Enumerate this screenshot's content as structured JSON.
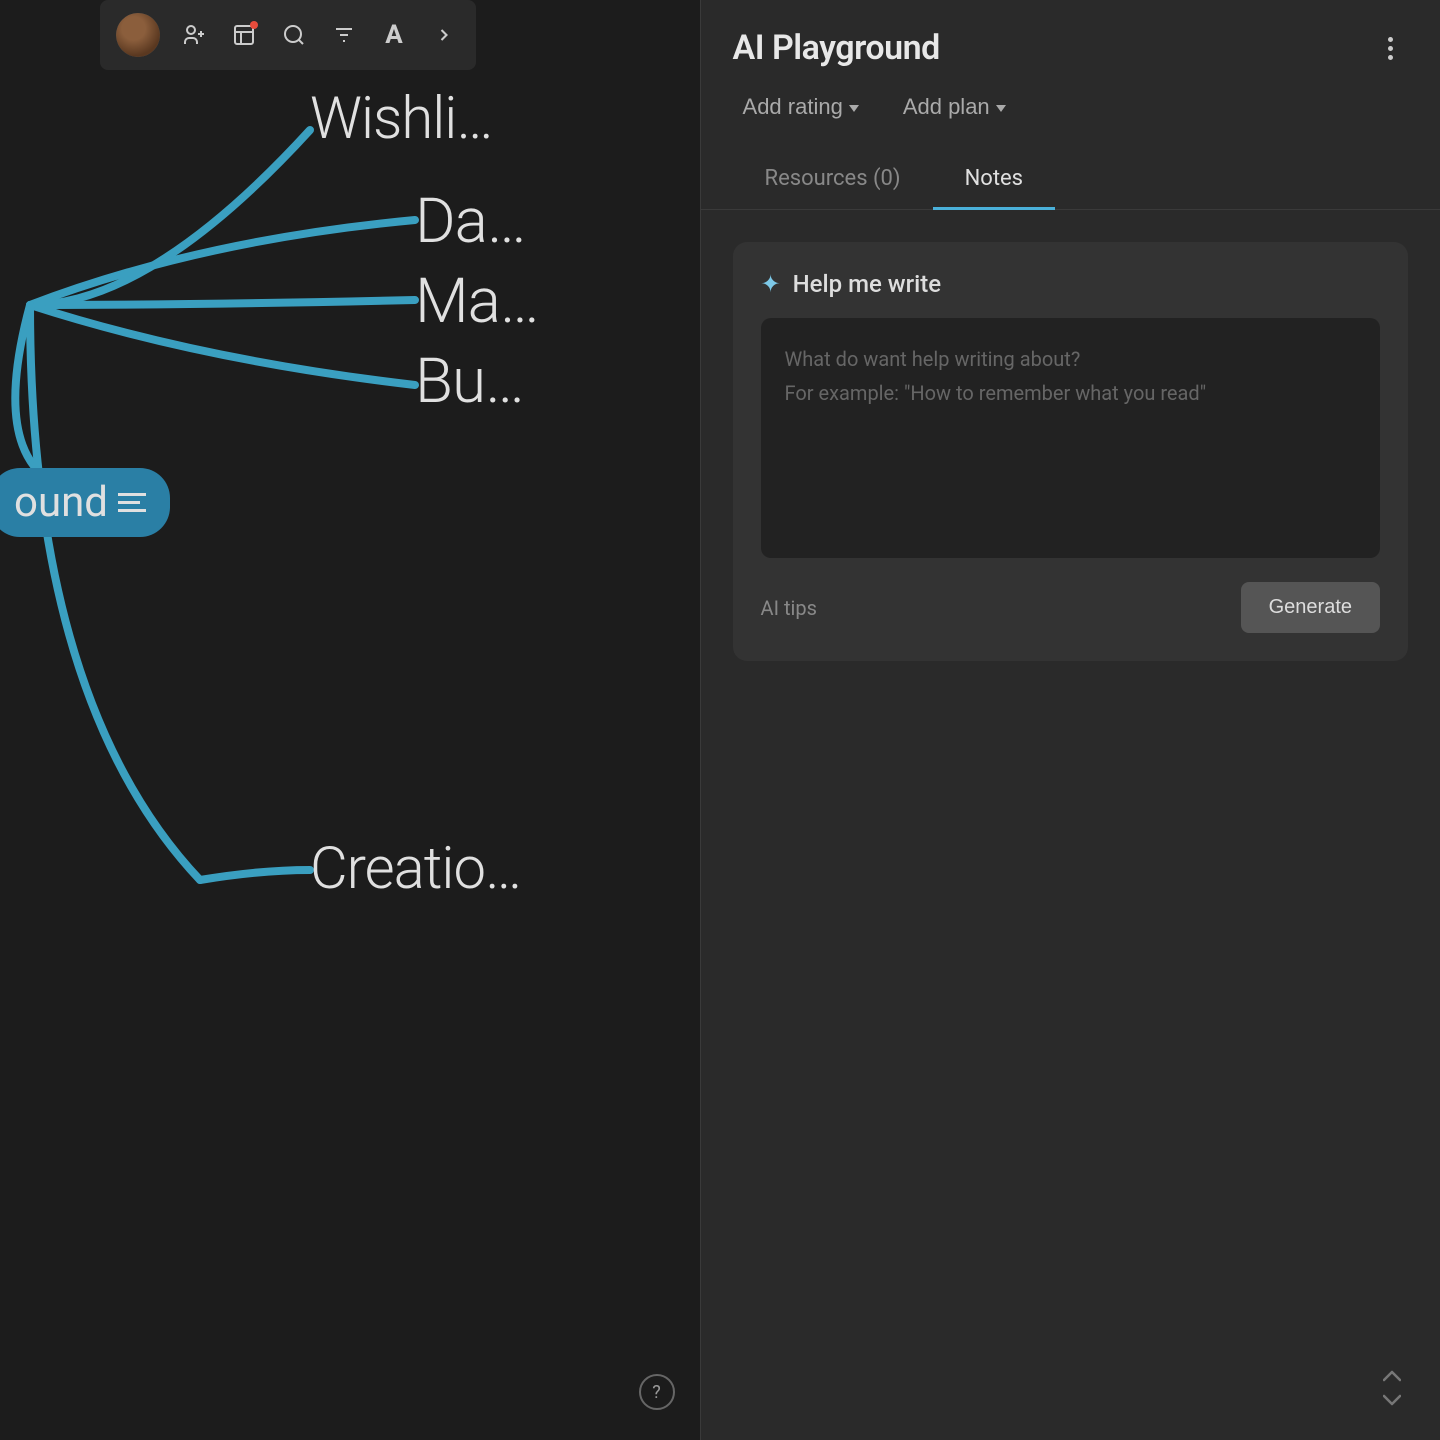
{
  "mindmap": {
    "nodes": {
      "wishlist": "Wishli…",
      "da": "Da…",
      "ma": "Ma…",
      "bu": "Bu…",
      "tag": "ound",
      "creation": "Creatio…"
    },
    "help_tooltip": "?"
  },
  "toolbar": {
    "icons": {
      "add_person": "add-person",
      "gallery": "gallery",
      "search": "search",
      "filter": "filter",
      "text": "A",
      "more": ">"
    }
  },
  "ai_panel": {
    "title": "AI Playground",
    "menu_label": "more-options",
    "actions": {
      "add_rating": "Add rating",
      "add_plan": "Add plan"
    },
    "tabs": {
      "resources": "Resources (0)",
      "notes": "Notes"
    },
    "help_write": {
      "title": "Help me write",
      "textarea_placeholder_line1": "What do want help writing about?",
      "textarea_placeholder_line2": "For example: \"How to remember what you read\"",
      "ai_tips": "AI tips",
      "generate_button": "Generate"
    },
    "scroll_up": "▲",
    "scroll_down": "▼"
  }
}
